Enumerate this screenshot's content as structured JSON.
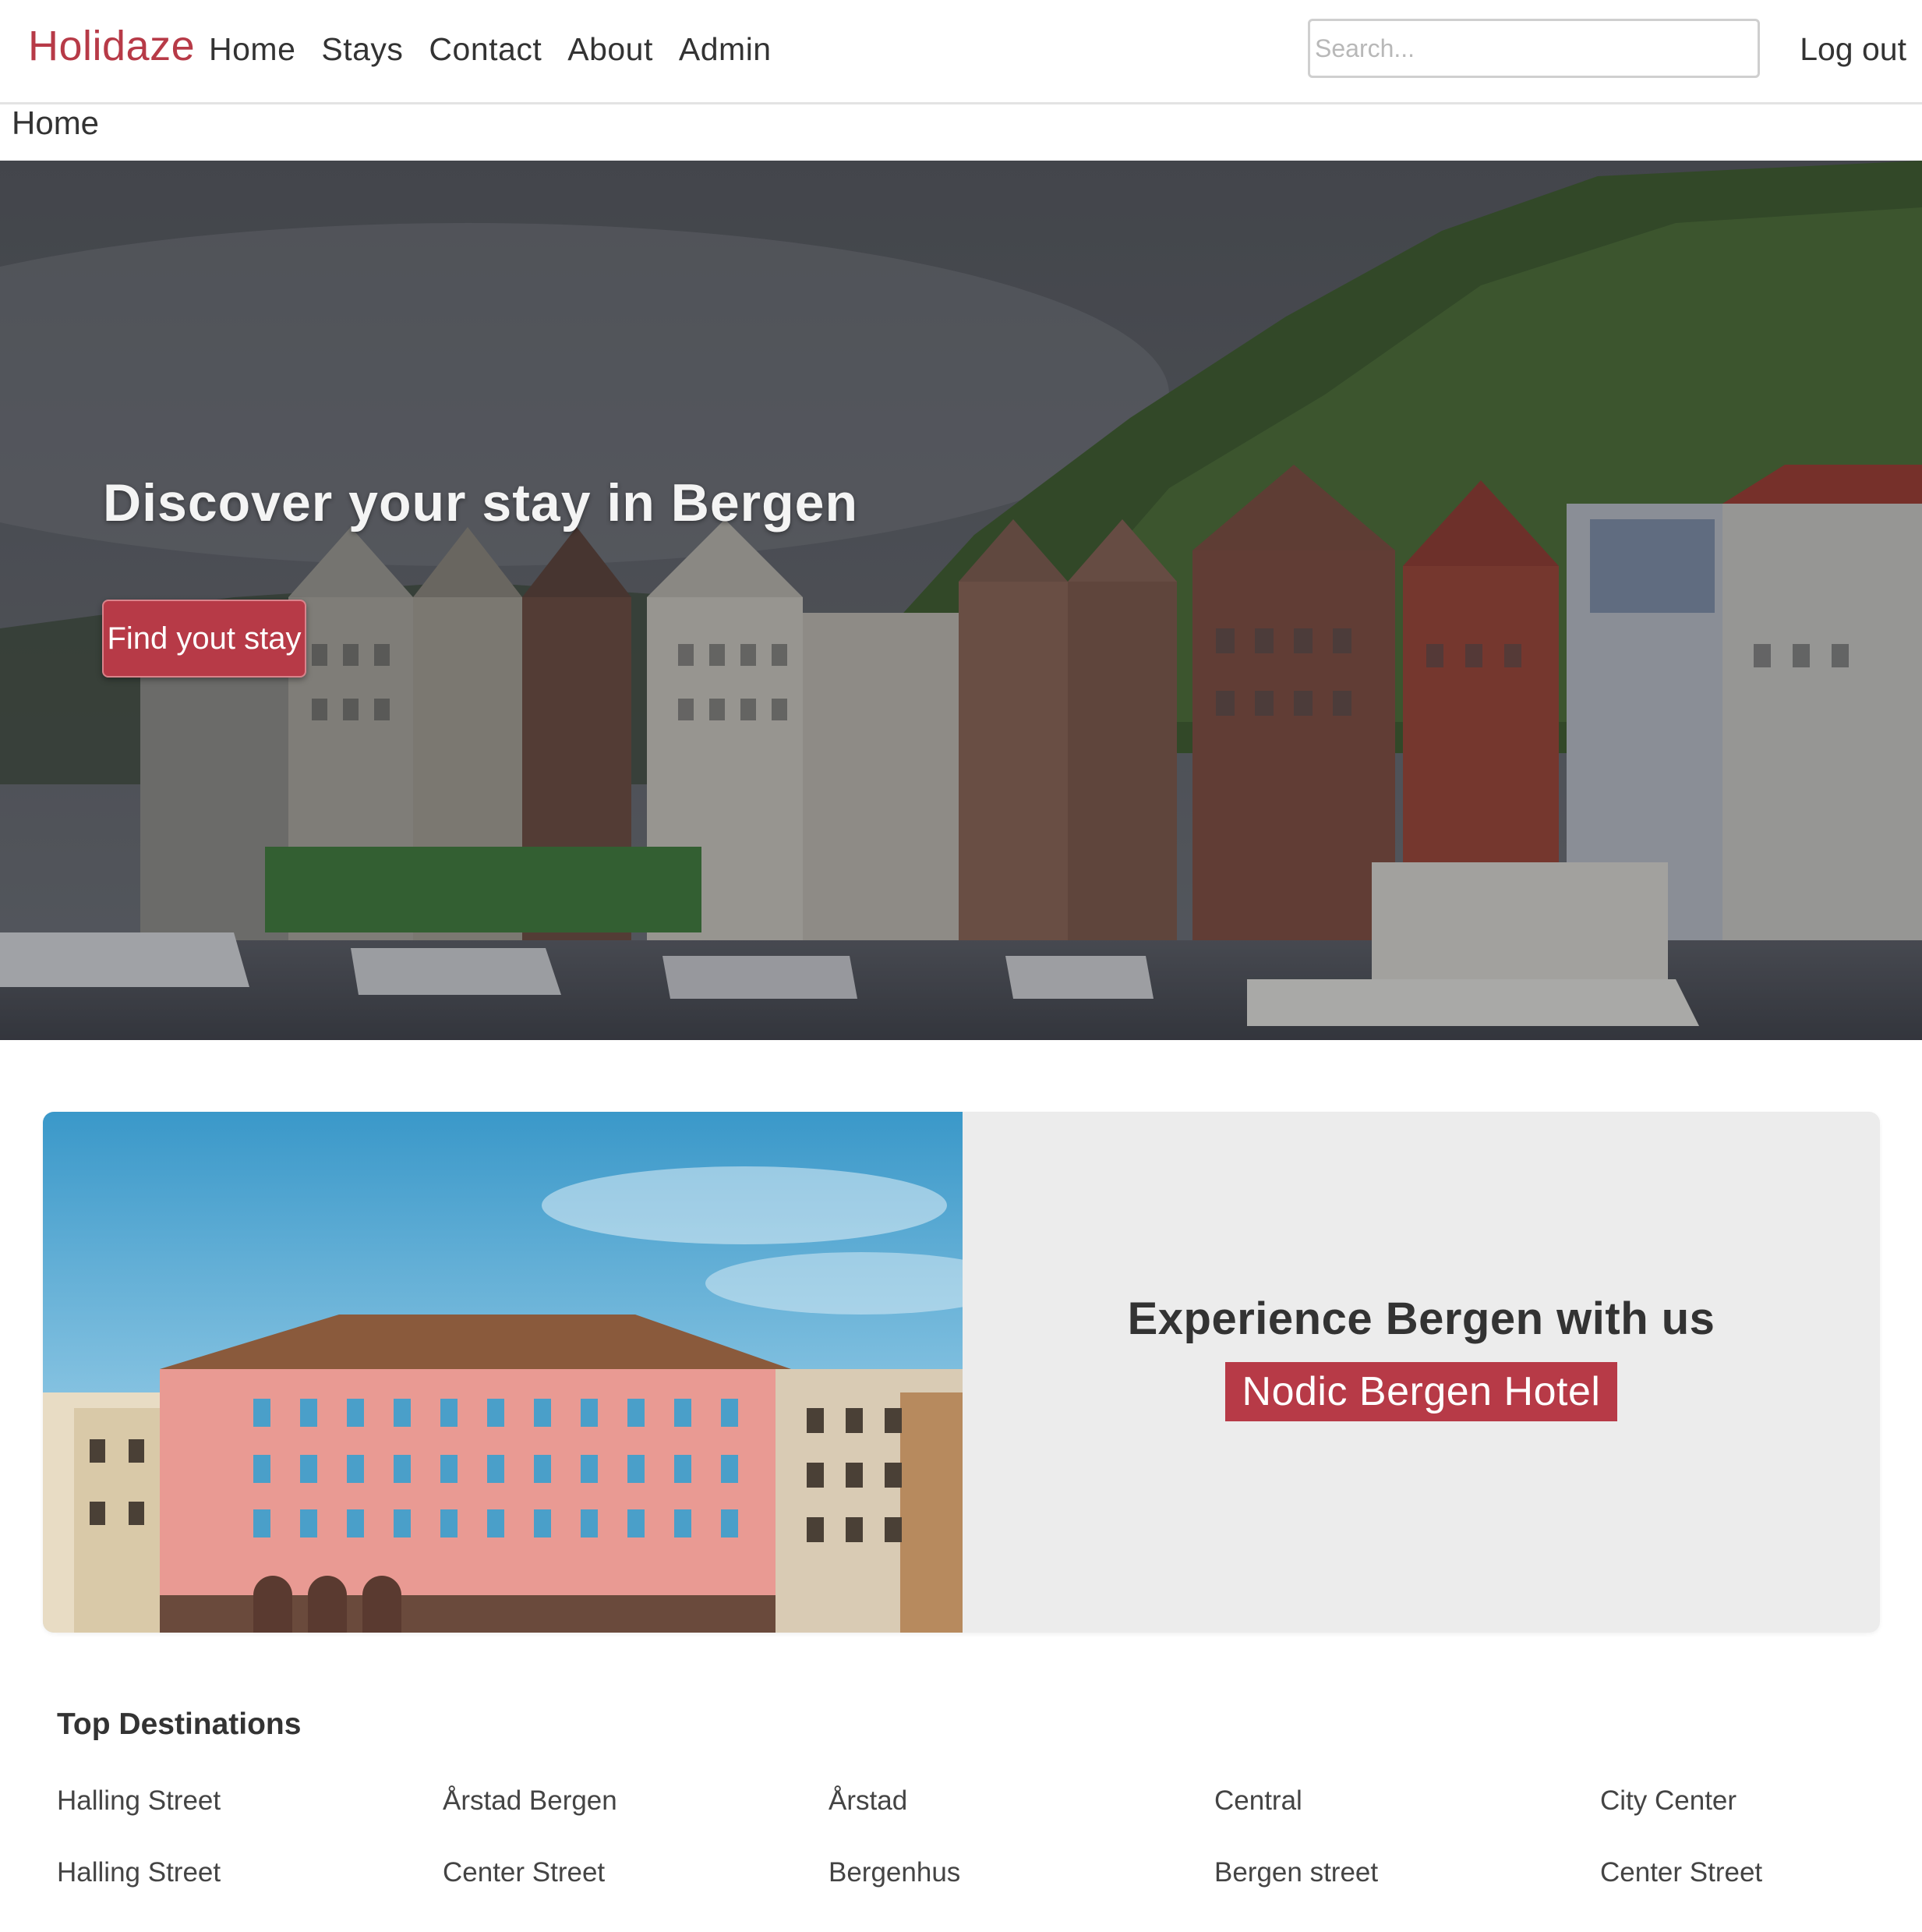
{
  "navbar": {
    "brand": "Holidaze",
    "links": [
      "Home",
      "Stays",
      "Contact",
      "About",
      "Admin"
    ],
    "search_placeholder": "Search...",
    "logout": "Log out",
    "brand_color": "#b73a47"
  },
  "breadcrumb": "Home",
  "hero": {
    "title": "Discover your stay in Bergen",
    "button": "Find yout stay"
  },
  "feature": {
    "heading": "Experience Bergen with us",
    "hotel": "Nodic Bergen Hotel"
  },
  "destinations": {
    "title": "Top Destinations",
    "rows": [
      [
        "Halling Street",
        "Årstad Bergen",
        "Årstad",
        "Central",
        "City Center"
      ],
      [
        "Halling Street",
        "Center Street",
        "Bergenhus",
        "Bergen street",
        "Center Street"
      ]
    ]
  }
}
